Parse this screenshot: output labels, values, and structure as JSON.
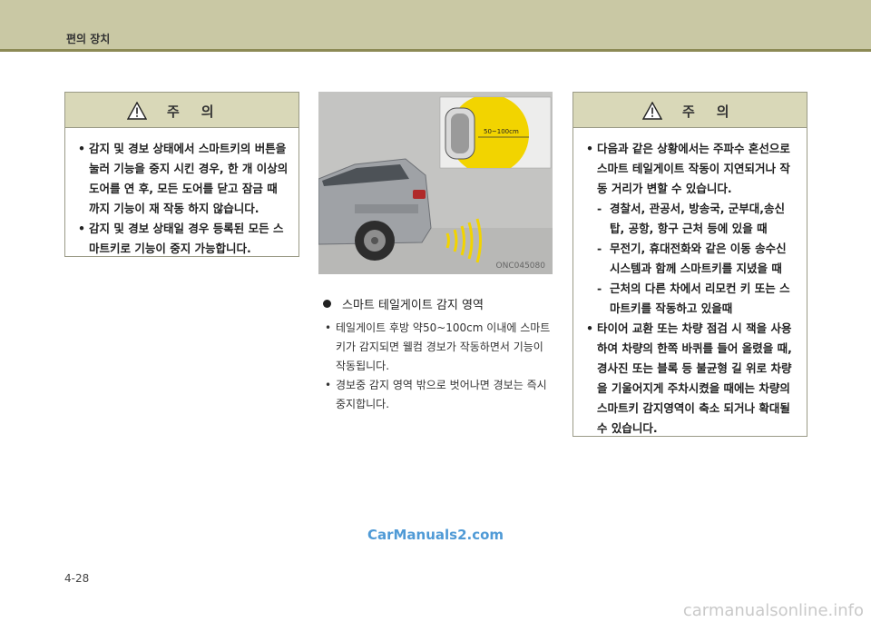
{
  "header": {
    "title": "편의 장치"
  },
  "caution_left": {
    "title": "주의",
    "items": [
      {
        "bullet": "•",
        "text": "감지 및 경보 상태에서 스마트키의 버튼을 눌러 기능을 중지 시킨 경우, 한 개 이상의 도어를 연 후, 모든 도어를 닫고 잠금 때 까지 기능이 재 작동 하지 않습니다."
      },
      {
        "bullet": "•",
        "text": "감지 및 경보 상태일 경우 등록된 모든 스마트키로 기능이 중지 가능합니다."
      }
    ]
  },
  "figure": {
    "range_label": "50~100cm",
    "code": "ONC045080"
  },
  "section": {
    "heading": "스마트 테일게이트 감지 영역",
    "items": [
      {
        "bullet": "•",
        "text": "테일게이트 후방 약50~100cm 이내에 스마트키가  감지되면 웰컴 경보가 작동하면서 기능이 작동됩니다."
      },
      {
        "bullet": "•",
        "text": "경보중 감지 영역 밖으로 벗어나면 경보는 즉시 중지합니다."
      }
    ]
  },
  "caution_right": {
    "title": "주의",
    "items": [
      {
        "bullet": "•",
        "text": "다음과 같은 상황에서는 주파수 혼선으로 스마트 테일게이트 작동이 지연되거나 작동 거리가 변할 수 있습니다."
      },
      {
        "bullet": "-",
        "text": "경찰서, 관공서, 방송국, 군부대,송신탑, 공항, 항구 근처 등에 있을 때"
      },
      {
        "bullet": "-",
        "text": "무전기, 휴대전화와 같은 이동 송수신 시스템과 함께 스마트키를 지녔을 때"
      },
      {
        "bullet": "-",
        "text": "근처의 다른 차에서 리모컨 키 또는 스마트키를 작동하고 있을때"
      },
      {
        "bullet": "•",
        "text": "타이어 교환 또는 차량 점검 시 잭을 사용하여 차량의 한쪽 바퀴를 들어 올렸을 때, 경사진 또는 블록 등 불균형 길 위로 차량을 기울어지게 주차시켰을 때에는 차량의 스마트키 감지영역이 축소 되거나 확대될 수 있습니다."
      }
    ]
  },
  "footer": {
    "page_number": "4-28",
    "watermark_primary": "CarManuals2.com",
    "watermark_secondary": "carmanualsonline.info"
  }
}
